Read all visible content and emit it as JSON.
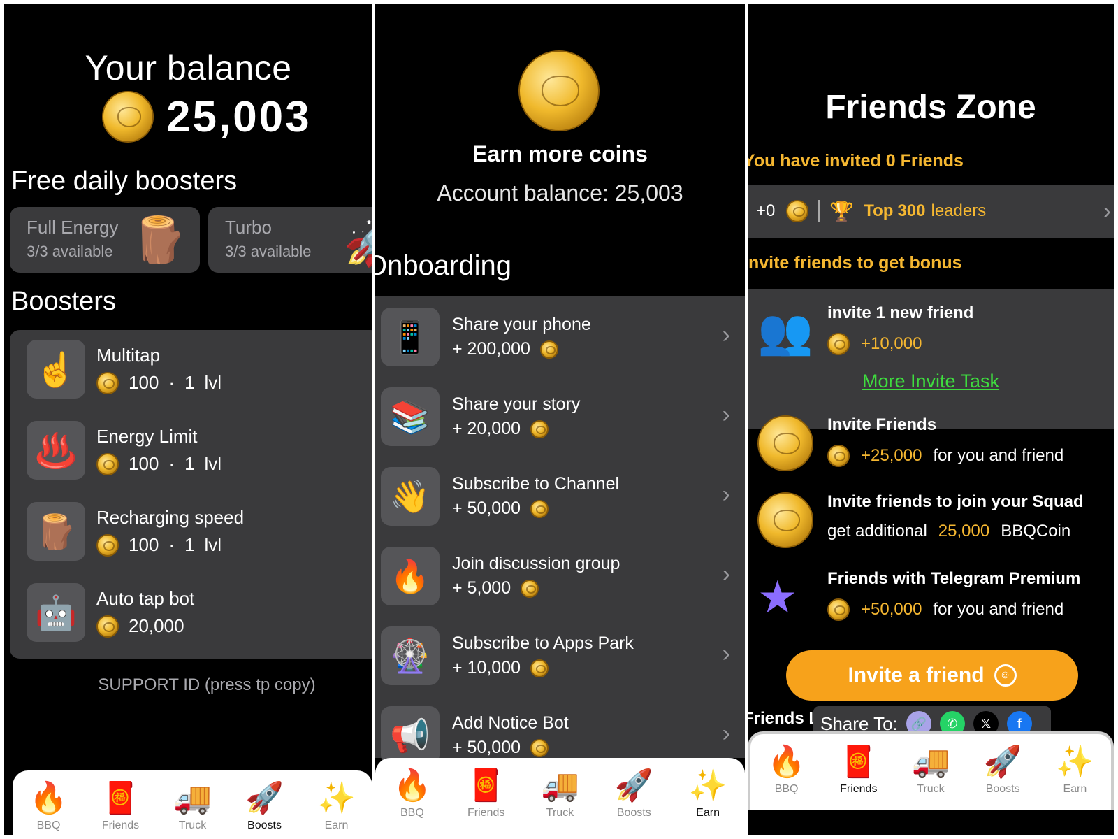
{
  "panel1": {
    "title": "Your balance",
    "balance": "25,003",
    "free_heading": "Free daily boosters",
    "free_cards": [
      {
        "title": "Full Energy",
        "sub": "3/3 available",
        "icon": "wood-log-icon"
      },
      {
        "title": "Turbo",
        "sub": "3/3 available",
        "icon": "rocket-icon"
      }
    ],
    "boosters_heading": "Boosters",
    "boosters": [
      {
        "name": "Multitap",
        "cost": "100",
        "dot": "·",
        "level": "1",
        "lvl": "lvl",
        "icon": "pointing-finger-icon"
      },
      {
        "name": "Energy Limit",
        "cost": "100",
        "dot": "·",
        "level": "1",
        "lvl": "lvl",
        "icon": "hot-springs-icon"
      },
      {
        "name": "Recharging speed",
        "cost": "100",
        "dot": "·",
        "level": "1",
        "lvl": "lvl",
        "icon": "wood-log-icon"
      },
      {
        "name": "Auto tap bot",
        "cost": "20,000",
        "icon": "robot-icon"
      }
    ],
    "support": "SUPPORT ID (press tp copy)",
    "nav_active": "Boosts"
  },
  "panel2": {
    "title": "Earn more coins",
    "subtitle": "Account balance: 25,003",
    "section": "Onboarding",
    "tasks": [
      {
        "name": "Share your phone",
        "reward": "+ 200,000",
        "icon": "mobile-phone-icon"
      },
      {
        "name": "Share your story",
        "reward": "+ 20,000",
        "icon": "books-icon"
      },
      {
        "name": "Subscribe to Channel",
        "reward": "+ 50,000",
        "icon": "waving-hand-icon"
      },
      {
        "name": "Join discussion group",
        "reward": "+ 5,000",
        "icon": "fire-icon"
      },
      {
        "name": "Subscribe to Apps Park",
        "reward": "+ 10,000",
        "icon": "ferris-wheel-icon"
      },
      {
        "name": "Add Notice Bot",
        "reward": "+ 50,000",
        "icon": "megaphone-icon"
      }
    ],
    "nav_active": "Earn"
  },
  "panel3": {
    "title": "Friends Zone",
    "invited": "You have invited 0 Friends",
    "lead_count": "+0",
    "lead_top": "Top",
    "lead_num": "300",
    "lead_leaders": "leaders",
    "invite_heading": "Invite friends to get bonus",
    "new_friend": {
      "title": "invite 1 new friend",
      "reward": "+10,000"
    },
    "more_link": "More Invite Task",
    "rows": [
      {
        "title": "Invite Friends",
        "reward": "+25,000",
        "suffix": "for you and friend"
      },
      {
        "title": "Invite friends to join your Squad",
        "prefix": "get additional",
        "reward": "25,000",
        "suffix": "BBQCoin"
      },
      {
        "title": "Friends with Telegram Premium",
        "reward": "+50,000",
        "suffix": "for you and friend"
      }
    ],
    "invite_button": "Invite a friend",
    "friends_list_label": "Friends L",
    "share_label": "Share To:",
    "nav_active": "Friends"
  },
  "nav": [
    {
      "label": "BBQ",
      "icon": "fire-icon",
      "emoji": "🔥"
    },
    {
      "label": "Friends",
      "icon": "red-envelope-icon",
      "emoji": "🧧"
    },
    {
      "label": "Truck",
      "icon": "food-truck-icon",
      "emoji": "🚚"
    },
    {
      "label": "Boosts",
      "icon": "rocket-icon",
      "emoji": "🚀"
    },
    {
      "label": "Earn",
      "icon": "sparkles-icon",
      "emoji": "✨"
    }
  ],
  "colors": {
    "accent": "#f7a21b",
    "gold_text": "#f5b731",
    "link_green": "#3fdc3f",
    "card": "#3a3a3c"
  }
}
